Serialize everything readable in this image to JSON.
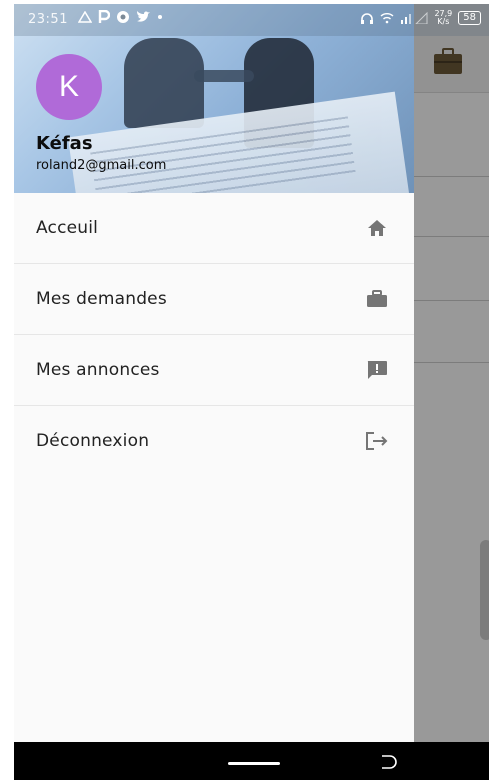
{
  "status_bar": {
    "time": "23:51",
    "speed_value": "27,9",
    "speed_unit": "K/s",
    "battery": "58"
  },
  "drawer": {
    "avatar_initial": "K",
    "user_name": "Kéfas",
    "user_email": "roland2@gmail.com",
    "menu": [
      {
        "label": "Acceuil",
        "icon": "home-icon"
      },
      {
        "label": "Mes demandes",
        "icon": "briefcase-icon"
      },
      {
        "label": "Mes annonces",
        "icon": "announcement-icon"
      },
      {
        "label": "Déconnexion",
        "icon": "logout-icon"
      }
    ]
  },
  "colors": {
    "avatar": "#b06ad8",
    "icon": "#757575",
    "navbar": "#000000"
  }
}
